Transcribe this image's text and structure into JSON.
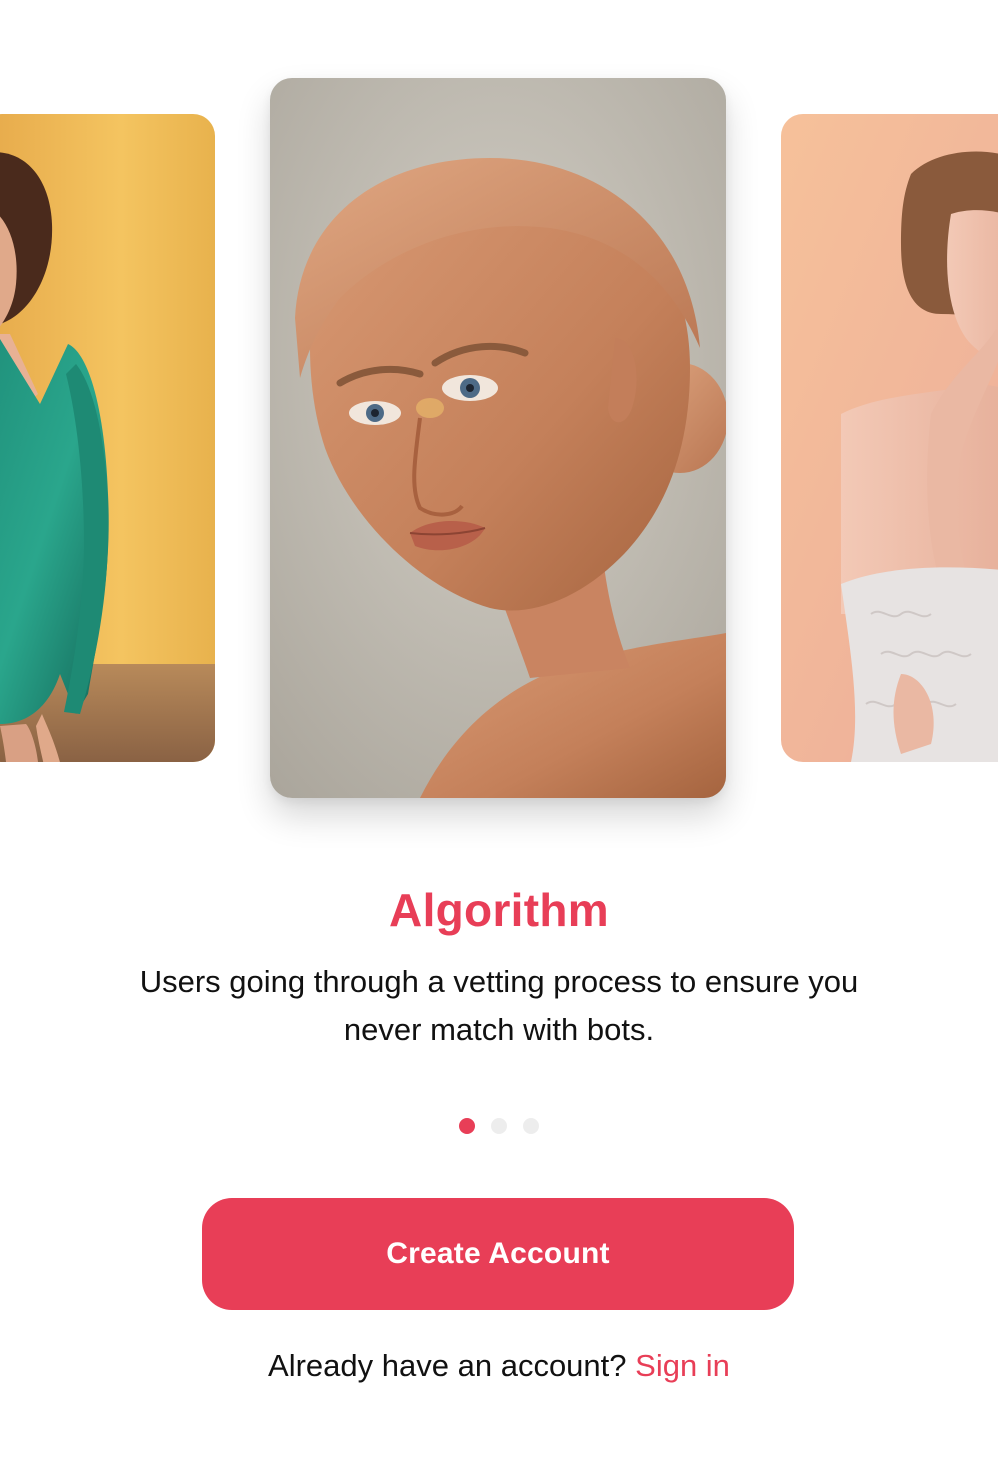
{
  "theme": {
    "accent": "#E83E57",
    "text": "#111111",
    "dot_inactive": "#EDEDED"
  },
  "carousel": {
    "cards": [
      {
        "position": "left",
        "icon": "photo-woman-green-sequin-dress"
      },
      {
        "position": "center",
        "icon": "photo-woman-portrait-gold-makeup"
      },
      {
        "position": "right",
        "icon": "photo-woman-lace-dress-peach"
      }
    ],
    "active_index": 0,
    "dot_count": 3
  },
  "onboarding": {
    "title": "Algorithm",
    "description": "Users going through a vetting process to ensure you never match with bots."
  },
  "actions": {
    "create_account_label": "Create Account",
    "signin_prompt": "Already have an account?",
    "signin_link": "Sign in"
  }
}
